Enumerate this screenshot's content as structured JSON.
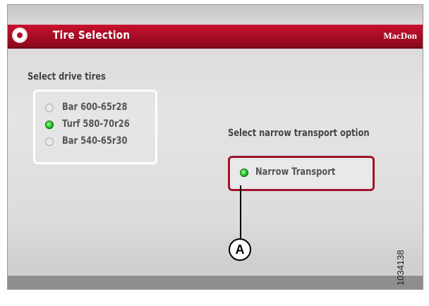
{
  "header": {
    "title": "Tire Selection",
    "brand": "MacDon",
    "accent_color": "#a40d24",
    "icon": "app-icon"
  },
  "drive_tires": {
    "label": "Select drive tires",
    "options": [
      {
        "label": "Bar 600-65r28",
        "selected": false
      },
      {
        "label": "Turf 580-70r26",
        "selected": true
      },
      {
        "label": "Bar 540-65r30",
        "selected": false
      }
    ]
  },
  "transport": {
    "label": "Select narrow transport option",
    "option": {
      "label": "Narrow Transport",
      "selected": true
    }
  },
  "callout": {
    "label": "A"
  },
  "figure_id": "1034138",
  "colors": {
    "selected_radio": "#1fc01f",
    "highlight_border": "#a0152a"
  }
}
